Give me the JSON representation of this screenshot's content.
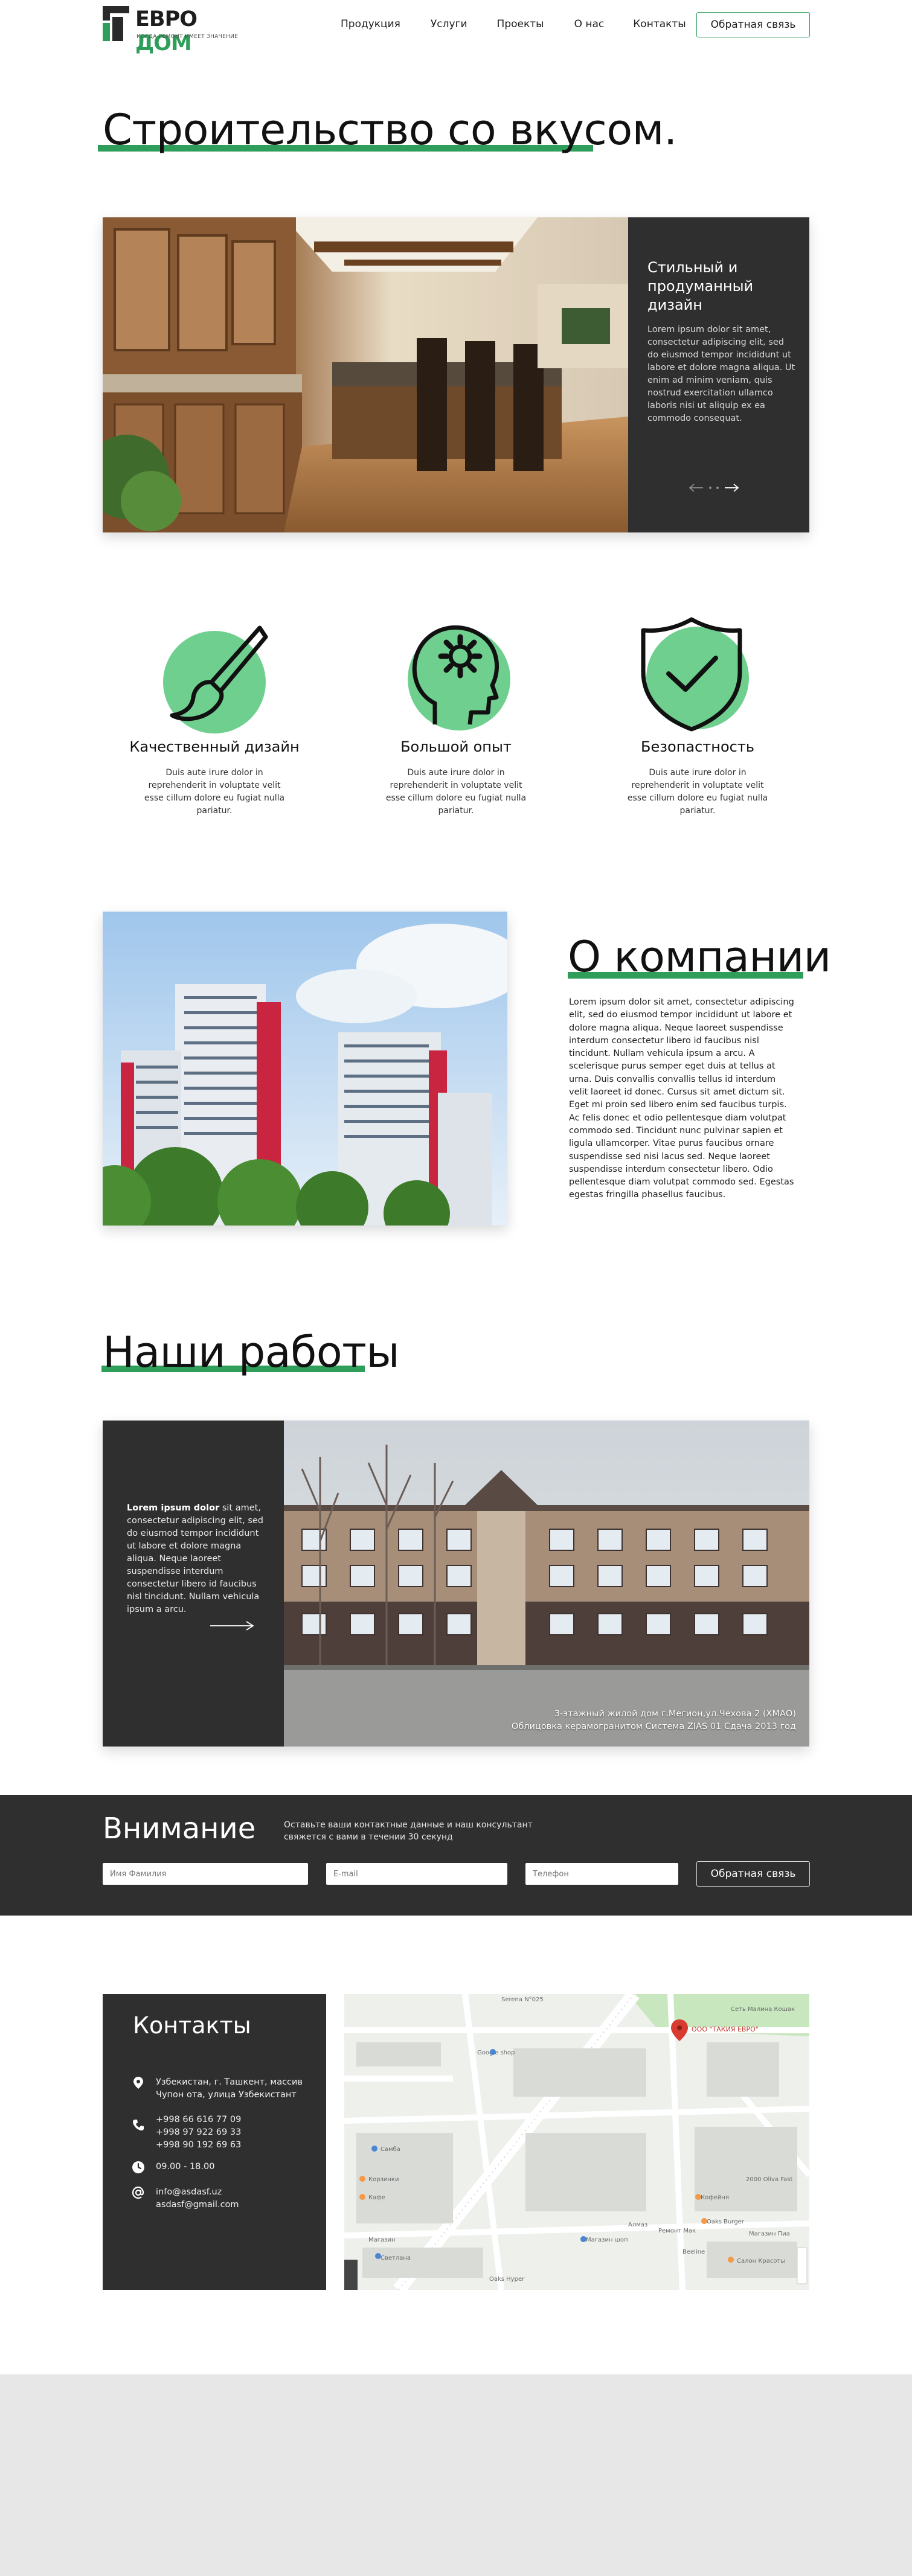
{
  "header": {
    "logo_word_a": "ЕВРО",
    "logo_word_b": "ДОМ",
    "logo_tagline": "КОГДА РЕМОНТ ИМЕЕТ ЗНАЧЕНИЕ",
    "nav": [
      "Продукция",
      "Услуги",
      "Проекты",
      "О нас",
      "Контакты"
    ],
    "cta": "Обратная связь"
  },
  "hero": {
    "title": "Строительство со вкусом.",
    "heading": "Стильный и продуманный дизайн",
    "text": "Lorem ipsum dolor sit amet, consectetur adipiscing elit, sed do eiusmod tempor incididunt ut labore et dolore magna aliqua. Ut enim ad minim veniam, quis nostrud exercitation ullamco laboris nisi ut aliquip ex ea commodo consequat."
  },
  "features": [
    {
      "icon": "paintbrush-icon",
      "title": "Качественный дизайн",
      "desc": "Duis aute irure dolor in reprehenderit in voluptate velit esse cillum dolore eu fugiat nulla pariatur."
    },
    {
      "icon": "head-gear-icon",
      "title": "Большой опыт",
      "desc": "Duis aute irure dolor in reprehenderit in voluptate velit esse cillum dolore eu fugiat nulla pariatur."
    },
    {
      "icon": "shield-check-icon",
      "title": "Безопастность",
      "desc": "Duis aute irure dolor in reprehenderit in voluptate velit esse cillum dolore eu fugiat nulla pariatur."
    }
  ],
  "about": {
    "title": "О компании",
    "text": "Lorem ipsum dolor sit amet, consectetur adipiscing elit, sed do eiusmod tempor incididunt ut labore et dolore magna aliqua. Neque laoreet suspendisse interdum consectetur libero id faucibus nisl tincidunt. Nullam vehicula ipsum a arcu. A scelerisque purus semper eget duis at tellus at urna. Duis convallis convallis tellus id interdum velit laoreet id donec. Cursus sit amet dictum sit. Eget mi proin sed libero enim sed faucibus turpis. Ac felis donec et odio pellentesque diam volutpat commodo sed. Tincidunt nunc pulvinar sapien et ligula ullamcorper. Vitae purus faucibus ornare suspendisse sed nisi lacus sed. Neque laoreet suspendisse interdum consectetur libero. Odio pellentesque diam volutpat commodo sed. Egestas egestas fringilla phasellus faucibus."
  },
  "works": {
    "title": "Наши работы",
    "lead": "Lorem ipsum dolor",
    "text": " sit amet, consectetur adipiscing elit, sed do eiusmod tempor incididunt ut labore et dolore magna aliqua. Neque laoreet suspendisse interdum consectetur libero id faucibus nisl tincidunt. Nullam vehicula ipsum a arcu.",
    "caption_1": "3-этажный жилой дом г.Мегион,ул.Чехова 2 (ХМАО)",
    "caption_2": "Облицовка керамогранитом Система ZIAS 01    Сдача 2013 год"
  },
  "attention": {
    "title": "Внимание",
    "note": "Оставьте ваши контактные данные и наш консультант свяжется с вами в течении 30 секунд",
    "name_placeholder": "Имя Фамилия",
    "email_placeholder": "E-mail",
    "phone_placeholder": "Телефон",
    "button": "Обратная связь"
  },
  "contacts": {
    "title": "Контакты",
    "address": "Узбекистан, г. Ташкент, массив Чупон ота, улица Узбекистант",
    "phones": [
      "+998 66 616 77 09",
      "+998 97 922 69 33",
      "+998 90 192 69 63"
    ],
    "hours": "09.00 - 18.00",
    "emails": [
      "info@asdasf.uz",
      "asdasf@gmail.com"
    ]
  },
  "map": {
    "pin_label": "ООО \"ТАКИЯ ЕВРО\"",
    "labels": [
      "Serena N°025",
      "Сеть Малина Кошак",
      "Google shop",
      "Самба",
      "Корзинки",
      "Кафе",
      "Магазин",
      "Светлана",
      "Магазин шоп",
      "Алмаз",
      "Ремонт Мак",
      "Кофейня",
      "Beeline",
      "Oaks Burger",
      "Магазин Пиа",
      "Салон Красоты",
      "Oaks Hyper",
      "2000 Oliva Fast"
    ]
  },
  "colors": {
    "accent": "#2f9e5a",
    "dark": "#2f2f2f",
    "feature_circle": "#6fcf8f"
  }
}
